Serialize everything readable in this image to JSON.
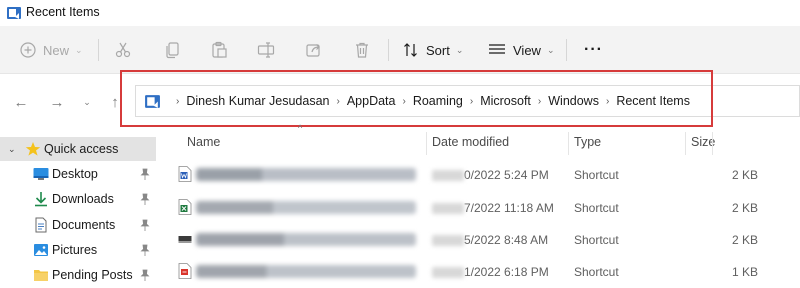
{
  "window": {
    "title": "Recent Items"
  },
  "toolbar": {
    "new_label": "New",
    "sort_label": "Sort",
    "view_label": "View",
    "more_label": "···",
    "icons": [
      "plus-icon",
      "cut-icon",
      "copy-icon",
      "paste-icon",
      "rename-icon",
      "share-icon",
      "delete-icon",
      "sort-icon",
      "view-icon"
    ]
  },
  "address": {
    "crumbs": [
      "Dinesh Kumar Jesudasan",
      "AppData",
      "Roaming",
      "Microsoft",
      "Windows",
      "Recent Items"
    ]
  },
  "sidebar": {
    "items": [
      {
        "label": "Quick access",
        "icon": "star-icon"
      },
      {
        "label": "Desktop",
        "icon": "desktop-icon"
      },
      {
        "label": "Downloads",
        "icon": "download-icon"
      },
      {
        "label": "Documents",
        "icon": "documents-icon"
      },
      {
        "label": "Pictures",
        "icon": "pictures-icon"
      },
      {
        "label": "Pending Posts",
        "icon": "folder-icon"
      }
    ]
  },
  "columns": {
    "name": "Name",
    "date": "Date modified",
    "type": "Type",
    "size": "Size"
  },
  "rows": [
    {
      "icon": "word-doc-icon",
      "date_visible": "0/2022 5:24 PM",
      "type": "Shortcut",
      "size": "2 KB"
    },
    {
      "icon": "excel-doc-icon",
      "date_visible": "7/2022 11:18 AM",
      "type": "Shortcut",
      "size": "2 KB"
    },
    {
      "icon": "file-icon",
      "date_visible": "5/2022 8:48 AM",
      "type": "Shortcut",
      "size": "2 KB"
    },
    {
      "icon": "pdf-doc-icon",
      "date_visible": "1/2022 6:18 PM",
      "type": "Shortcut",
      "size": "1 KB"
    }
  ],
  "colors": {
    "highlight": "#d63b3b",
    "selected": "#e3e3e3",
    "accent": "#1a73c7"
  }
}
